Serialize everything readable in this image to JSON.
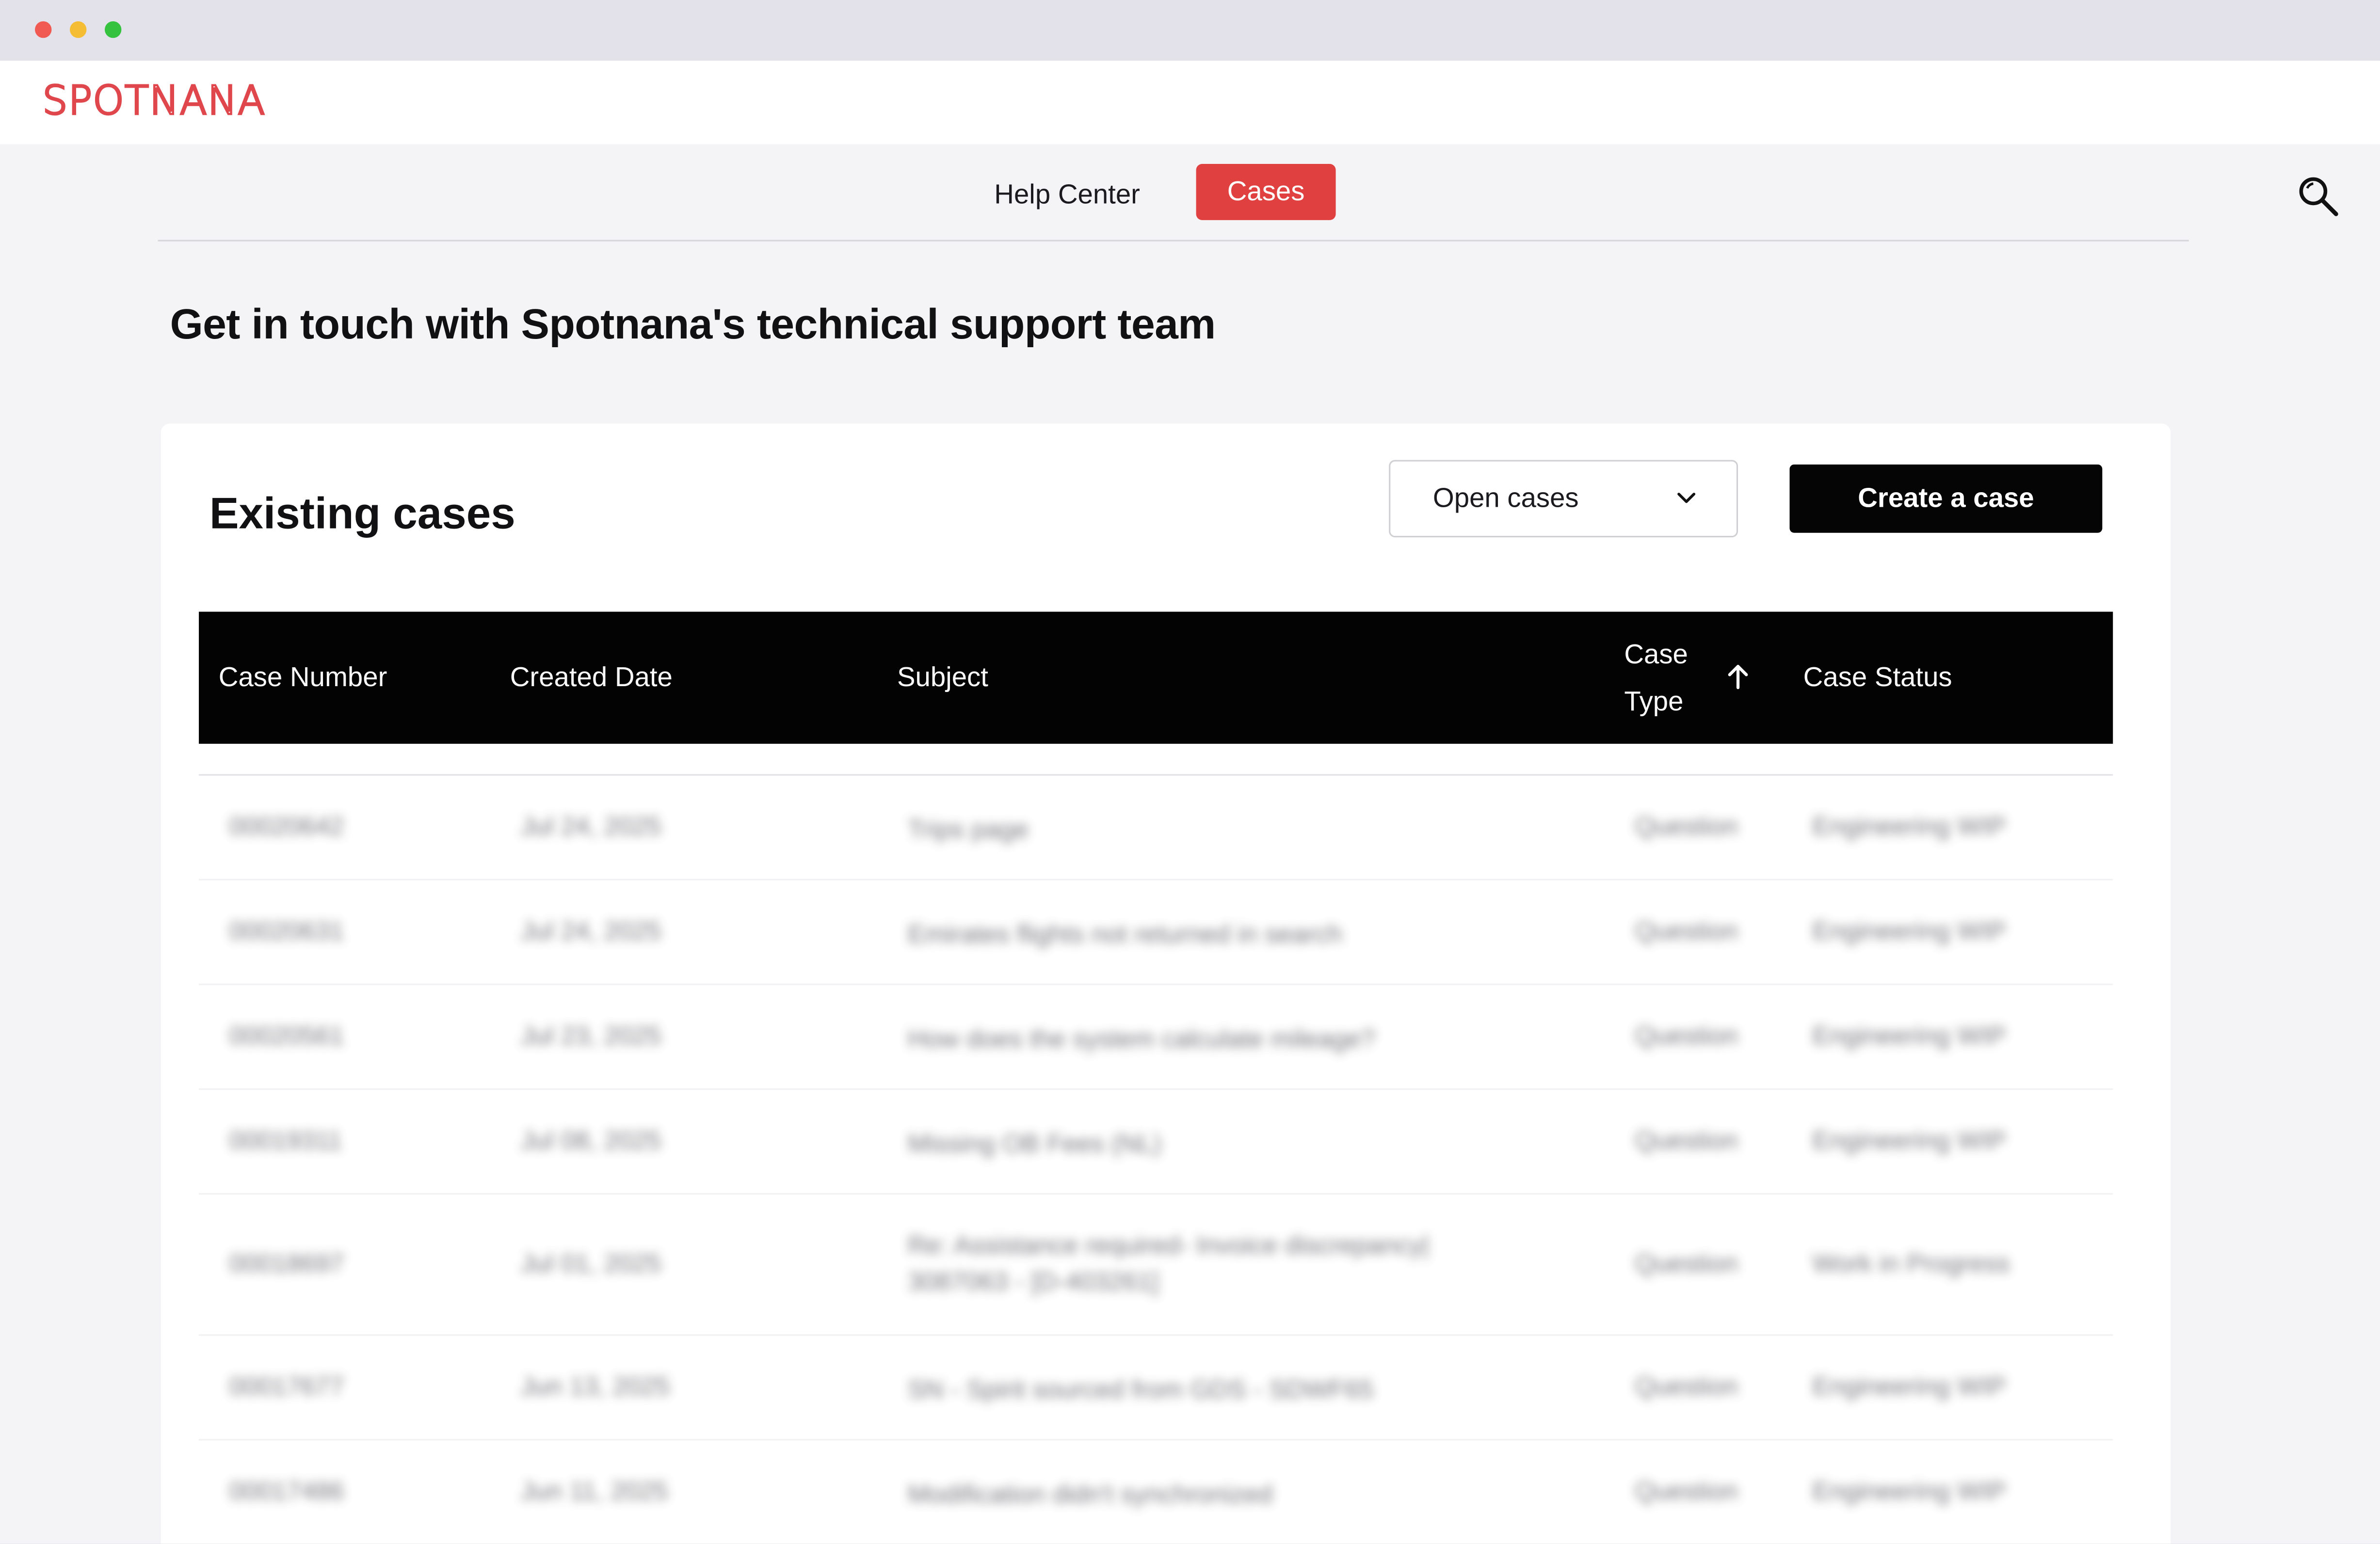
{
  "browser": {
    "dots": [
      "close",
      "minimize",
      "maximize"
    ],
    "colors": {
      "close": "#f05a52",
      "minimize": "#f5bd33",
      "maximize": "#34c23f"
    }
  },
  "brand": {
    "logo_text": "SPOTNANA",
    "color": "#e0474c"
  },
  "nav": {
    "items": [
      {
        "label": "Help Center",
        "active": false
      },
      {
        "label": "Cases",
        "active": true
      }
    ],
    "active_color": "#e0403f",
    "search_icon": "search-icon"
  },
  "page": {
    "title": "Get in touch with Spotnana's technical support team"
  },
  "cases_card": {
    "title": "Existing cases",
    "filter": {
      "selected": "Open cases",
      "icon": "chevron-down-icon"
    },
    "create_label": "Create a case"
  },
  "table": {
    "columns": [
      "Case Number",
      "Created Date",
      "Subject",
      "Case Type",
      "Case Status"
    ],
    "case_type_label_lines": [
      "Case",
      "Type"
    ],
    "sort_icon": "arrow-up-icon",
    "rows": [
      {
        "number": "00020642",
        "date": "Jul 24, 2025",
        "subject": "Trips page",
        "type": "Question",
        "status": "Engineering WIP"
      },
      {
        "number": "00020631",
        "date": "Jul 24, 2025",
        "subject": "Emirates flights not returned in search",
        "type": "Question",
        "status": "Engineering WIP"
      },
      {
        "number": "00020561",
        "date": "Jul 23, 2025",
        "subject": "How does the system calculate mileage?",
        "type": "Question",
        "status": "Engineering WIP"
      },
      {
        "number": "00019311",
        "date": "Jul 08, 2025",
        "subject": "Missing OB Fees (NL)",
        "type": "Question",
        "status": "Engineering WIP"
      },
      {
        "number": "00018697",
        "date": "Jul 01, 2025",
        "subject": "Re: Assistance required- Invoice discrepancy| 3087063 - [D-403261]",
        "type": "Question",
        "status": "Work in Progress"
      },
      {
        "number": "00017677",
        "date": "Jun 13, 2025",
        "subject": "SN - Spirit sourced from GDS - SDWF65",
        "type": "Question",
        "status": "Engineering WIP"
      },
      {
        "number": "00017486",
        "date": "Jun 11, 2025",
        "subject": "Modification didn't synchronized",
        "type": "Question",
        "status": "Engineering WIP"
      }
    ]
  }
}
